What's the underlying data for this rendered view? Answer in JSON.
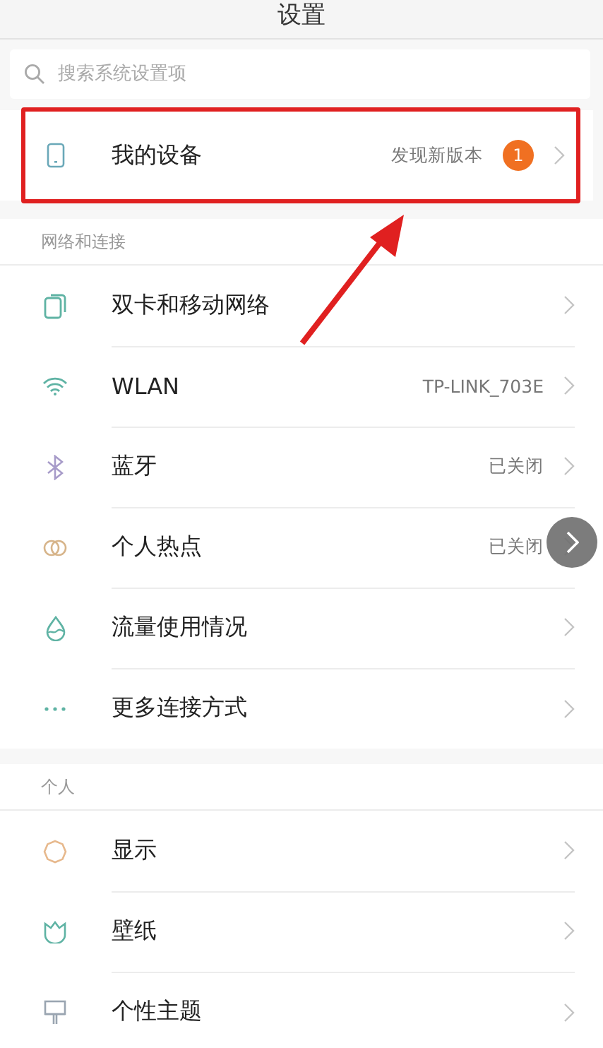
{
  "header": {
    "title": "设置"
  },
  "search": {
    "placeholder": "搜索系统设置项"
  },
  "device_row": {
    "label": "我的设备",
    "value": "发现新版本",
    "badge": "1",
    "highlighted": true
  },
  "sections": [
    {
      "title": "网络和连接",
      "items": [
        {
          "label": "双卡和移动网络"
        },
        {
          "label": "WLAN",
          "value": "TP-LINK_703E"
        },
        {
          "label": "蓝牙",
          "value": "已关闭"
        },
        {
          "label": "个人热点",
          "value": "已关闭"
        },
        {
          "label": "流量使用情况"
        },
        {
          "label": "更多连接方式"
        }
      ]
    },
    {
      "title": "个人",
      "items": [
        {
          "label": "显示"
        },
        {
          "label": "壁纸"
        },
        {
          "label": "个性主题"
        }
      ]
    }
  ],
  "annotation": {
    "kind": "arrow"
  },
  "floating_button": {
    "kind": "forward"
  }
}
